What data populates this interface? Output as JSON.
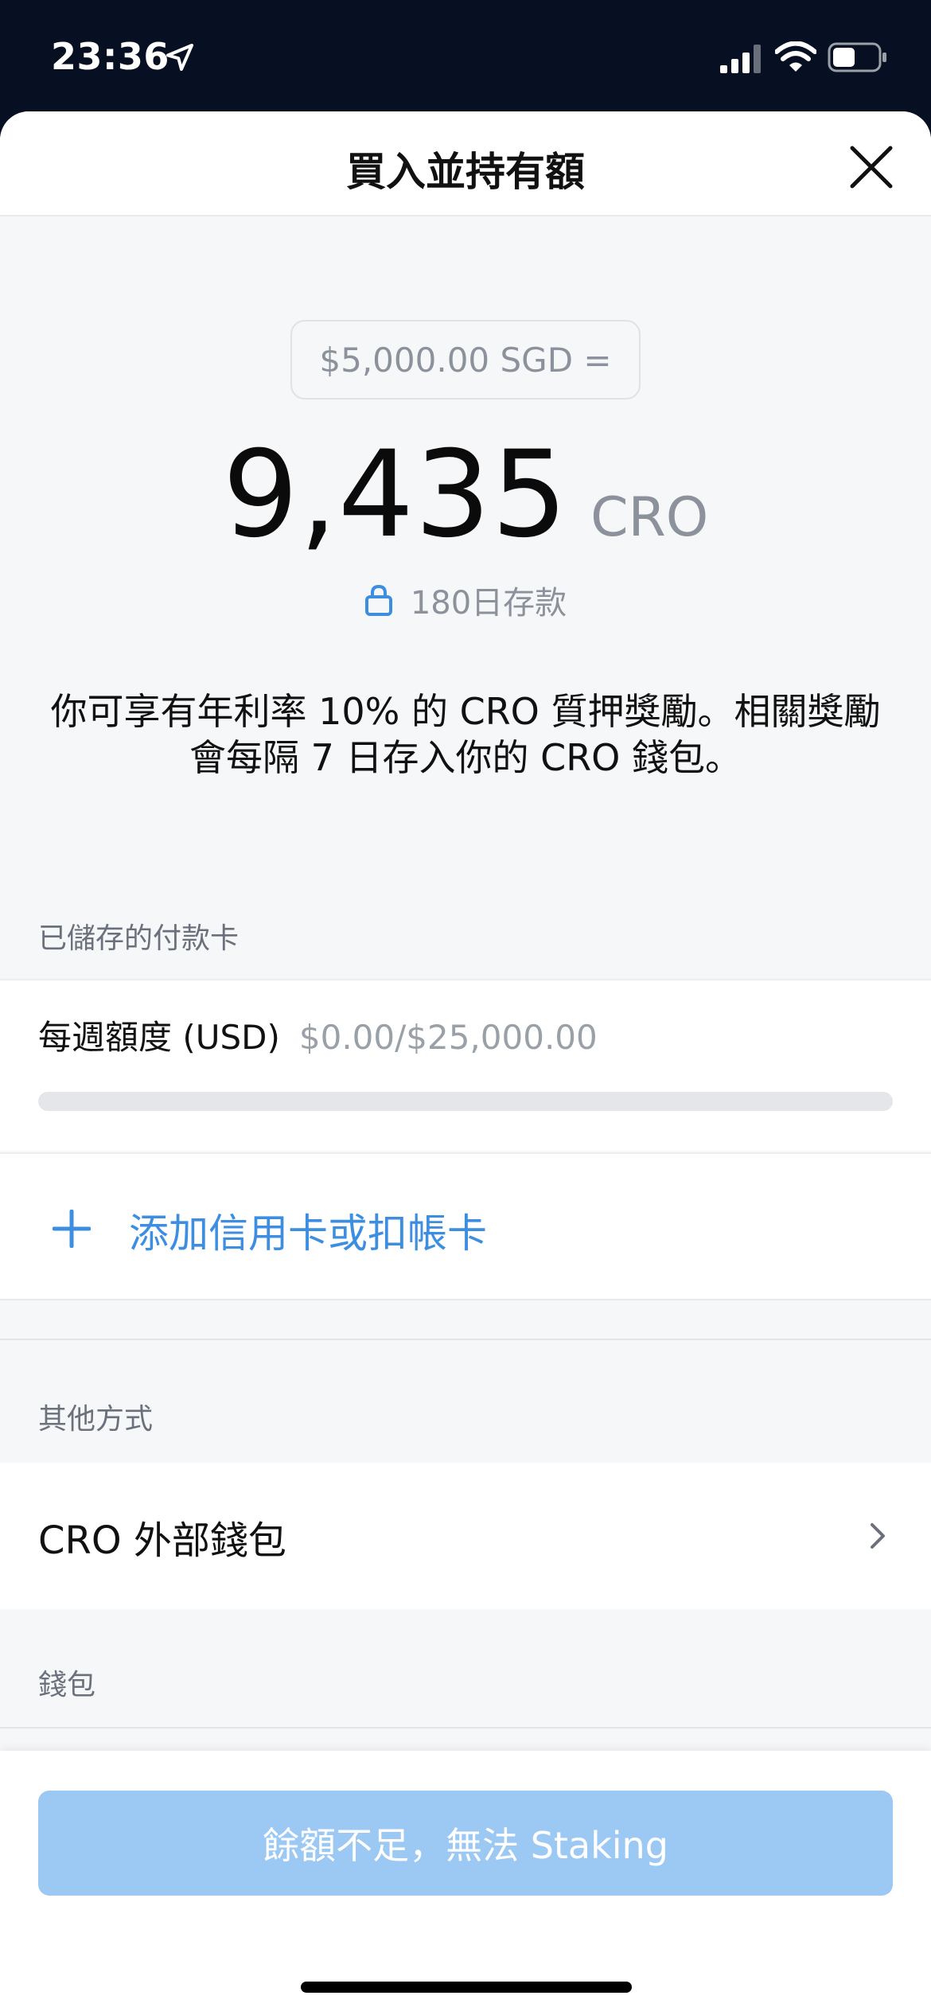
{
  "status_bar": {
    "time": "23:36",
    "battery_level": 0.5
  },
  "sheet": {
    "title": "買入並持有額"
  },
  "amount": {
    "fiat_equivalent": "$5,000.00 SGD =",
    "crypto_amount": "9,435",
    "crypto_unit": "CRO",
    "lock_period": "180日存款"
  },
  "description": "你可享有年利率 10% 的 CRO 質押獎勵。相關獎勵會每隔 7 日存入你的 CRO 錢包。",
  "saved_cards": {
    "section_title": "已儲存的付款卡",
    "weekly_limit_label": "每週額度 (USD)",
    "weekly_limit_value": "$0.00/$25,000.00",
    "weekly_limit_used_fraction": 0,
    "add_card_label": "添加信用卡或扣帳卡"
  },
  "other_methods": {
    "section_title": "其他方式",
    "external_wallet_label": "CRO 外部錢包"
  },
  "wallet": {
    "section_title": "錢包"
  },
  "footer": {
    "stake_button_label": "餘額不足，無法 Staking"
  },
  "colors": {
    "accent": "#1199fa",
    "disabled_button": "#9cc8f4",
    "link_blue": "#3d8ee0"
  }
}
